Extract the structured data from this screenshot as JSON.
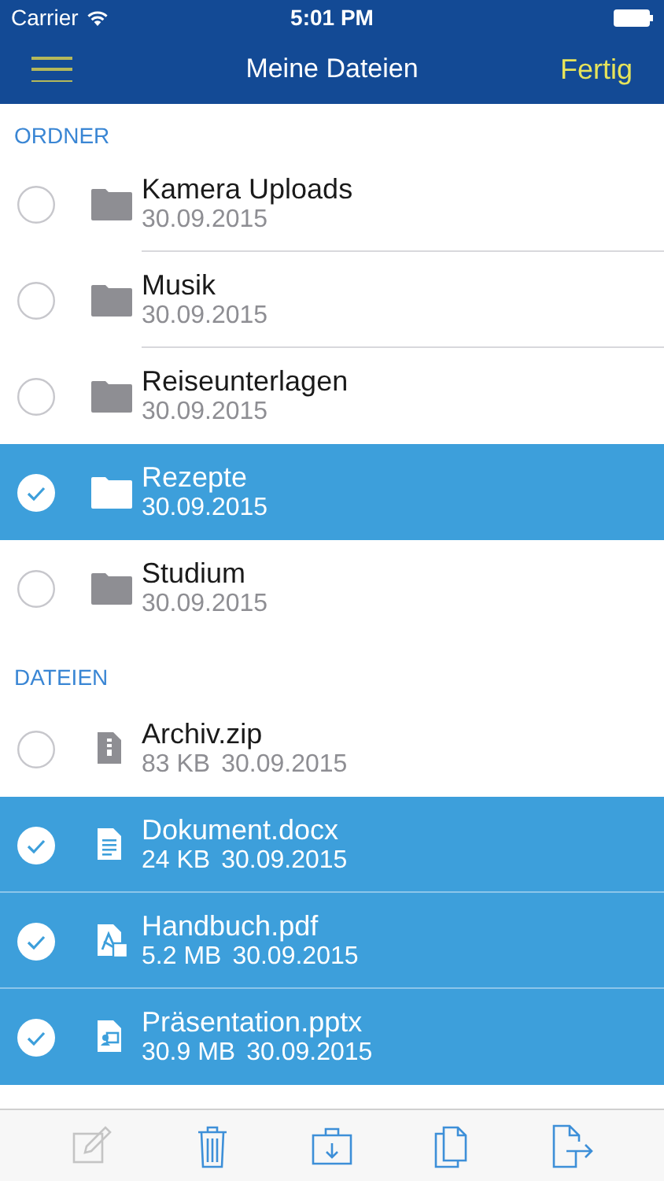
{
  "status_bar": {
    "carrier": "Carrier",
    "time": "5:01 PM"
  },
  "nav": {
    "title": "Meine Dateien",
    "done": "Fertig"
  },
  "sections": [
    {
      "title": "ORDNER",
      "items": [
        {
          "kind": "folder",
          "name": "Kamera Uploads",
          "date": "30.09.2015",
          "selected": false
        },
        {
          "kind": "folder",
          "name": "Musik",
          "date": "30.09.2015",
          "selected": false
        },
        {
          "kind": "folder",
          "name": "Reiseunterlagen",
          "date": "30.09.2015",
          "selected": false
        },
        {
          "kind": "folder",
          "name": "Rezepte",
          "date": "30.09.2015",
          "selected": true
        },
        {
          "kind": "folder",
          "name": "Studium",
          "date": "30.09.2015",
          "selected": false
        }
      ]
    },
    {
      "title": "DATEIEN",
      "items": [
        {
          "kind": "archive",
          "name": "Archiv.zip",
          "size": "83 KB",
          "date": "30.09.2015",
          "selected": false
        },
        {
          "kind": "document",
          "name": "Dokument.docx",
          "size": "24 KB",
          "date": "30.09.2015",
          "selected": true
        },
        {
          "kind": "pdf",
          "name": "Handbuch.pdf",
          "size": "5.2 MB",
          "date": "30.09.2015",
          "selected": true
        },
        {
          "kind": "presentation",
          "name": "Präsentation.pptx",
          "size": "30.9 MB",
          "date": "30.09.2015",
          "selected": true
        }
      ]
    }
  ],
  "toolbar": [
    {
      "kind": "edit",
      "disabled": true
    },
    {
      "kind": "delete",
      "disabled": false
    },
    {
      "kind": "download",
      "disabled": false
    },
    {
      "kind": "copy",
      "disabled": false
    },
    {
      "kind": "move",
      "disabled": false
    }
  ]
}
